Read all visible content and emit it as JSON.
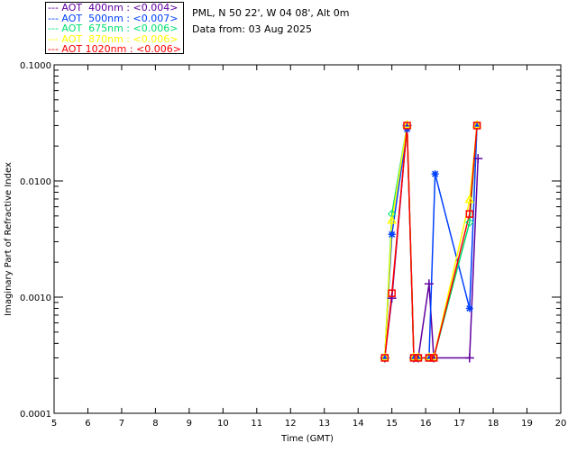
{
  "header": {
    "site": "PML, N 50 22', W 04 08', Alt 0m",
    "date": "Data from: 03 Aug 2025"
  },
  "chart_data": {
    "type": "line",
    "title": "",
    "xlabel": "Time (GMT)",
    "ylabel": "Imaginary Part of Refractive Index",
    "xlim": [
      5,
      20
    ],
    "ylim": [
      0.0001,
      0.1
    ],
    "yscale": "log",
    "grid": false,
    "legend_placement": "top-left outside",
    "xticks": [
      "5",
      "6",
      "7",
      "8",
      "9",
      "10",
      "11",
      "12",
      "13",
      "14",
      "15",
      "16",
      "17",
      "18",
      "19",
      "20"
    ],
    "yticks": [
      "0.0001",
      "0.0010",
      "0.0100",
      "0.1000"
    ],
    "series": [
      {
        "name": "AOT  400nm : <0.004>",
        "color": "#6000a0",
        "marker": "plus",
        "points": [
          [
            14.79,
            0.0003
          ],
          [
            15.0,
            0.00098
          ],
          [
            15.45,
            0.03
          ],
          [
            15.65,
            0.0003
          ],
          [
            15.78,
            0.0003
          ],
          [
            16.1,
            0.0013
          ],
          [
            16.24,
            0.0003
          ],
          [
            17.3,
            0.0003
          ],
          [
            17.55,
            0.0156
          ]
        ]
      },
      {
        "name": "AOT  500nm : <0.007>",
        "color": "#0040ff",
        "marker": "star",
        "points": [
          [
            14.79,
            0.0003
          ],
          [
            15.0,
            0.00347
          ],
          [
            15.45,
            0.028
          ],
          [
            15.65,
            0.0003
          ],
          [
            15.78,
            0.0003
          ],
          [
            16.1,
            0.0003
          ],
          [
            16.28,
            0.0115
          ],
          [
            17.3,
            0.0008
          ],
          [
            17.52,
            0.03
          ]
        ]
      },
      {
        "name": "AOT  675nm : <0.006>",
        "color": "#00e070",
        "marker": "diamond",
        "points": [
          [
            14.79,
            0.0003
          ],
          [
            15.0,
            0.0052
          ],
          [
            15.45,
            0.03
          ],
          [
            15.65,
            0.0003
          ],
          [
            15.78,
            0.0003
          ],
          [
            16.1,
            0.0003
          ],
          [
            16.24,
            0.0003
          ],
          [
            17.3,
            0.0044
          ],
          [
            17.52,
            0.03
          ]
        ]
      },
      {
        "name": "AOT  870nm : <0.006>",
        "color": "#ffff00",
        "marker": "triangle",
        "points": [
          [
            14.79,
            0.0003
          ],
          [
            15.0,
            0.0045
          ],
          [
            15.45,
            0.03
          ],
          [
            15.65,
            0.0003
          ],
          [
            15.78,
            0.0003
          ],
          [
            16.1,
            0.0003
          ],
          [
            16.24,
            0.0003
          ],
          [
            17.3,
            0.0068
          ],
          [
            17.52,
            0.03
          ]
        ]
      },
      {
        "name": "AOT 1020nm : <0.006>",
        "color": "#ff0000",
        "marker": "square",
        "points": [
          [
            14.79,
            0.0003
          ],
          [
            15.0,
            0.00108
          ],
          [
            15.45,
            0.03
          ],
          [
            15.65,
            0.0003
          ],
          [
            15.78,
            0.0003
          ],
          [
            16.1,
            0.0003
          ],
          [
            16.24,
            0.0003
          ],
          [
            17.3,
            0.0052
          ],
          [
            17.52,
            0.03
          ]
        ]
      }
    ]
  }
}
